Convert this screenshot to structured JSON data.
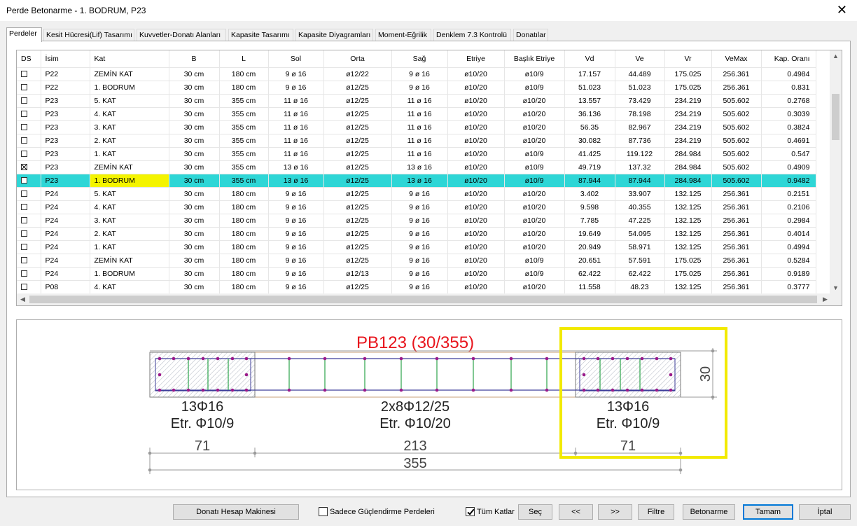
{
  "window": {
    "title": "Perde Betonarme - 1. BODRUM, P23",
    "close_glyph": "✕"
  },
  "tabs": [
    "Perdeler",
    "Kesit Hücresi(Lif) Tasarımı",
    "Kuvvetler-Donatı Alanları",
    "Kapasite Tasarımı",
    "Kapasite Diyagramları",
    "Moment-Eğrilik",
    "Denklem 7.3 Kontrolü",
    "Donatılar"
  ],
  "table": {
    "columns": [
      "DS",
      "İsim",
      "Kat",
      "B",
      "L",
      "Sol",
      "Orta",
      "Sağ",
      "Etriye",
      "Başlık Etriye",
      "Vd",
      "Ve",
      "Vr",
      "VeMax",
      "Kap. Oranı"
    ],
    "selected_index": 8,
    "rows": [
      {
        "ds": false,
        "cells": [
          "P22",
          "ZEMİN KAT",
          "30 cm",
          "180 cm",
          "9 ø 16",
          "ø12/22",
          "9 ø 16",
          "ø10/20",
          "ø10/9",
          "17.157",
          "44.489",
          "175.025",
          "256.361",
          "0.4984"
        ]
      },
      {
        "ds": false,
        "cells": [
          "P22",
          "1. BODRUM",
          "30 cm",
          "180 cm",
          "9 ø 16",
          "ø12/25",
          "9 ø 16",
          "ø10/20",
          "ø10/9",
          "51.023",
          "51.023",
          "175.025",
          "256.361",
          "0.831"
        ]
      },
      {
        "ds": false,
        "cells": [
          "P23",
          "5. KAT",
          "30 cm",
          "355 cm",
          "11 ø 16",
          "ø12/25",
          "11 ø 16",
          "ø10/20",
          "ø10/20",
          "13.557",
          "73.429",
          "234.219",
          "505.602",
          "0.2768"
        ]
      },
      {
        "ds": false,
        "cells": [
          "P23",
          "4. KAT",
          "30 cm",
          "355 cm",
          "11 ø 16",
          "ø12/25",
          "11 ø 16",
          "ø10/20",
          "ø10/20",
          "36.136",
          "78.198",
          "234.219",
          "505.602",
          "0.3039"
        ]
      },
      {
        "ds": false,
        "cells": [
          "P23",
          "3. KAT",
          "30 cm",
          "355 cm",
          "11 ø 16",
          "ø12/25",
          "11 ø 16",
          "ø10/20",
          "ø10/20",
          "56.35",
          "82.967",
          "234.219",
          "505.602",
          "0.3824"
        ]
      },
      {
        "ds": false,
        "cells": [
          "P23",
          "2. KAT",
          "30 cm",
          "355 cm",
          "11 ø 16",
          "ø12/25",
          "11 ø 16",
          "ø10/20",
          "ø10/20",
          "30.082",
          "87.736",
          "234.219",
          "505.602",
          "0.4691"
        ]
      },
      {
        "ds": false,
        "cells": [
          "P23",
          "1. KAT",
          "30 cm",
          "355 cm",
          "11 ø 16",
          "ø12/25",
          "11 ø 16",
          "ø10/20",
          "ø10/9",
          "41.425",
          "119.122",
          "284.984",
          "505.602",
          "0.547"
        ]
      },
      {
        "ds": true,
        "cells": [
          "P23",
          "ZEMİN KAT",
          "30 cm",
          "355 cm",
          "13 ø 16",
          "ø12/25",
          "13 ø 16",
          "ø10/20",
          "ø10/9",
          "49.719",
          "137.32",
          "284.984",
          "505.602",
          "0.4909"
        ]
      },
      {
        "ds": false,
        "cells": [
          "P23",
          "1. BODRUM",
          "30 cm",
          "355 cm",
          "13 ø 16",
          "ø12/25",
          "13 ø 16",
          "ø10/20",
          "ø10/9",
          "87.944",
          "87.944",
          "284.984",
          "505.602",
          "0.9482"
        ]
      },
      {
        "ds": false,
        "cells": [
          "P24",
          "5. KAT",
          "30 cm",
          "180 cm",
          "9 ø 16",
          "ø12/25",
          "9 ø 16",
          "ø10/20",
          "ø10/20",
          "3.402",
          "33.907",
          "132.125",
          "256.361",
          "0.2151"
        ]
      },
      {
        "ds": false,
        "cells": [
          "P24",
          "4. KAT",
          "30 cm",
          "180 cm",
          "9 ø 16",
          "ø12/25",
          "9 ø 16",
          "ø10/20",
          "ø10/20",
          "9.598",
          "40.355",
          "132.125",
          "256.361",
          "0.2106"
        ]
      },
      {
        "ds": false,
        "cells": [
          "P24",
          "3. KAT",
          "30 cm",
          "180 cm",
          "9 ø 16",
          "ø12/25",
          "9 ø 16",
          "ø10/20",
          "ø10/20",
          "7.785",
          "47.225",
          "132.125",
          "256.361",
          "0.2984"
        ]
      },
      {
        "ds": false,
        "cells": [
          "P24",
          "2. KAT",
          "30 cm",
          "180 cm",
          "9 ø 16",
          "ø12/25",
          "9 ø 16",
          "ø10/20",
          "ø10/20",
          "19.649",
          "54.095",
          "132.125",
          "256.361",
          "0.4014"
        ]
      },
      {
        "ds": false,
        "cells": [
          "P24",
          "1. KAT",
          "30 cm",
          "180 cm",
          "9 ø 16",
          "ø12/25",
          "9 ø 16",
          "ø10/20",
          "ø10/20",
          "20.949",
          "58.971",
          "132.125",
          "256.361",
          "0.4994"
        ]
      },
      {
        "ds": false,
        "cells": [
          "P24",
          "ZEMİN KAT",
          "30 cm",
          "180 cm",
          "9 ø 16",
          "ø12/25",
          "9 ø 16",
          "ø10/20",
          "ø10/9",
          "20.651",
          "57.591",
          "175.025",
          "256.361",
          "0.5284"
        ]
      },
      {
        "ds": false,
        "cells": [
          "P24",
          "1. BODRUM",
          "30 cm",
          "180 cm",
          "9 ø 16",
          "ø12/13",
          "9 ø 16",
          "ø10/20",
          "ø10/9",
          "62.422",
          "62.422",
          "175.025",
          "256.361",
          "0.9189"
        ]
      },
      {
        "ds": false,
        "cells": [
          "P08",
          "4. KAT",
          "30 cm",
          "180 cm",
          "9 ø 16",
          "ø12/25",
          "9 ø 16",
          "ø10/20",
          "ø10/20",
          "11.558",
          "48.23",
          "132.125",
          "256.361",
          "0.3777"
        ]
      }
    ]
  },
  "drawing": {
    "title": "PB123 (30/355)",
    "left_label_1": "13Φ16",
    "left_label_2": "Etr. Φ10/9",
    "mid_label_1": "2x8Φ12/25",
    "mid_label_2": "Etr. Φ10/20",
    "right_label_1": "13Φ16",
    "right_label_2": "Etr. Φ10/9",
    "dim_left": "71",
    "dim_mid": "213",
    "dim_right": "71",
    "dim_total": "355",
    "dim_thickness": "30",
    "title_color": "#e8141c",
    "highlight_color": "#f2ea00"
  },
  "bottom": {
    "calc_button": "Donatı Hesap Makinesi",
    "only_strengthened": "Sadece Güçlendirme Perdeleri",
    "all_floors": "Tüm Katlar",
    "select": "Seç",
    "prev": "<<",
    "next": ">>",
    "filter": "Filtre",
    "concrete": "Betonarme",
    "ok": "Tamam",
    "cancel": "İptal"
  }
}
